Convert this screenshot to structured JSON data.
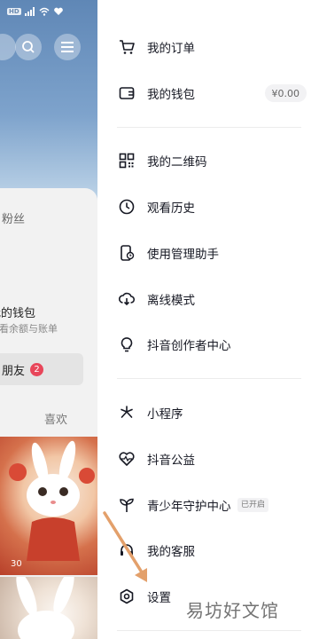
{
  "status_bar": {
    "chip": "HD"
  },
  "background": {
    "profile": {
      "fans_label": "粉丝",
      "wallet_label": "我的钱包",
      "wallet_sub": "查看余额与账单",
      "friends_label": "朋友",
      "friends_badge": "2",
      "likes_tab": "喜欢"
    },
    "video": {
      "play_count": "30"
    }
  },
  "drawer": {
    "menu": [
      {
        "id": "orders",
        "label": "我的订单",
        "icon": "cart-icon"
      },
      {
        "id": "wallet",
        "label": "我的钱包",
        "icon": "wallet-icon",
        "balance": "¥0.00"
      },
      {
        "id": "qrcode",
        "label": "我的二维码",
        "icon": "qrcode-icon"
      },
      {
        "id": "history",
        "label": "观看历史",
        "icon": "clock-icon"
      },
      {
        "id": "usage",
        "label": "使用管理助手",
        "icon": "phone-timer-icon"
      },
      {
        "id": "offline",
        "label": "离线模式",
        "icon": "cloud-download-icon"
      },
      {
        "id": "creator",
        "label": "抖音创作者中心",
        "icon": "lightbulb-icon"
      },
      {
        "id": "miniapp",
        "label": "小程序",
        "icon": "asterisk-icon"
      },
      {
        "id": "charity",
        "label": "抖音公益",
        "icon": "heart-pulse-icon"
      },
      {
        "id": "teen",
        "label": "青少年守护中心",
        "icon": "sprout-icon",
        "tag": "已开启"
      },
      {
        "id": "service",
        "label": "我的客服",
        "icon": "headset-icon"
      },
      {
        "id": "settings",
        "label": "设置",
        "icon": "hexagon-gear-icon"
      }
    ]
  },
  "watermark": "易坊好文馆",
  "colors": {
    "arrow": "#e3a06b",
    "badge": "#e8465a"
  }
}
